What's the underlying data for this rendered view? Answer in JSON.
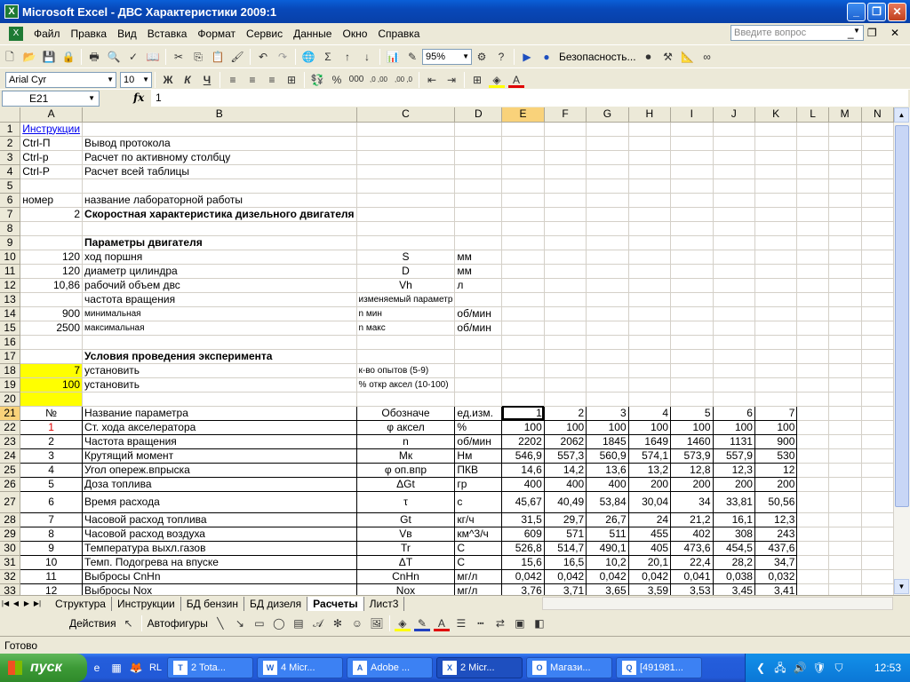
{
  "window": {
    "title": "Microsoft Excel - ДВС Характеристики 2009:1",
    "min": "_",
    "max": "❐",
    "close": "✕"
  },
  "menu": {
    "items": [
      "Файл",
      "Правка",
      "Вид",
      "Вставка",
      "Формат",
      "Сервис",
      "Данные",
      "Окно",
      "Справка"
    ],
    "help_placeholder": "Введите вопрос",
    "doc_buttons": "_ ❐ ✕"
  },
  "toolbar1": {
    "zoom": "95%",
    "security": "Безопасность..."
  },
  "toolbar2": {
    "font": "Arial Cyr",
    "size": "10",
    "bold": "Ж",
    "italic": "К",
    "underline": "Ч",
    "percent": "%",
    "thousands": "000",
    "dec_inc": ",0 ,00",
    "dec_dec": ",00 ,0"
  },
  "formula": {
    "cell": "E21",
    "fx": "fx",
    "value": "1"
  },
  "columns": [
    "A",
    "B",
    "C",
    "D",
    "E",
    "F",
    "G",
    "H",
    "I",
    "J",
    "K",
    "L",
    "M",
    "N"
  ],
  "rows": [
    {
      "n": "1",
      "A": "Инструкции"
    },
    {
      "n": "2",
      "A": "Ctrl-П",
      "B": "Вывод протокола"
    },
    {
      "n": "3",
      "A": "Ctrl-р",
      "B": "Расчет по активному столбцу"
    },
    {
      "n": "4",
      "A": "Ctrl-Р",
      "B": "Расчет всей таблицы"
    },
    {
      "n": "5"
    },
    {
      "n": "6",
      "A": "номер",
      "B": "название лабораторной работы"
    },
    {
      "n": "7",
      "A": "2",
      "B": "Скоростная характеристика дизельного двигателя"
    },
    {
      "n": "8"
    },
    {
      "n": "9",
      "B": "Параметры двигателя"
    },
    {
      "n": "10",
      "A": "120",
      "B": "ход поршня",
      "C": "S",
      "D": "мм"
    },
    {
      "n": "11",
      "A": "120",
      "B": "диаметр цилиндра",
      "C": "D",
      "D": "мм"
    },
    {
      "n": "12",
      "A": "10,86",
      "B": "рабочий объем двс",
      "C": "Vh",
      "D": "л"
    },
    {
      "n": "13",
      "B": "частота вращения",
      "C": "изменяемый параметр"
    },
    {
      "n": "14",
      "A": "900",
      "B": "минимальная",
      "C": "n мин",
      "D": "об/мин"
    },
    {
      "n": "15",
      "A": "2500",
      "B": "максимальная",
      "C": "n макс",
      "D": "об/мин"
    },
    {
      "n": "16"
    },
    {
      "n": "17",
      "B": "Условия проведения эксперимента"
    },
    {
      "n": "18",
      "A": "7",
      "B": "установить",
      "C": "к-во опытов (5-9)"
    },
    {
      "n": "19",
      "A": "100",
      "B": "установить",
      "C": "% откр аксел (10-100)"
    },
    {
      "n": "20"
    },
    {
      "n": "21",
      "A": "№",
      "B": "Название параметра",
      "C": "Обозначе",
      "D": "ед.изм.",
      "E": "1",
      "F": "2",
      "G": "3",
      "H": "4",
      "I": "5",
      "J": "6",
      "K": "7"
    },
    {
      "n": "22",
      "A": "1",
      "B": "Ст. хода акселератора",
      "C": "φ аксел",
      "D": "%",
      "E": "100",
      "F": "100",
      "G": "100",
      "H": "100",
      "I": "100",
      "J": "100",
      "K": "100"
    },
    {
      "n": "23",
      "A": "2",
      "B": "Частота вращения",
      "C": "n",
      "D": "об/мин",
      "E": "2202",
      "F": "2062",
      "G": "1845",
      "H": "1649",
      "I": "1460",
      "J": "1131",
      "K": "900"
    },
    {
      "n": "24",
      "A": "3",
      "B": "Крутящий момент",
      "C": "Мк",
      "D": "Нм",
      "E": "546,9",
      "F": "557,3",
      "G": "560,9",
      "H": "574,1",
      "I": "573,9",
      "J": "557,9",
      "K": "530"
    },
    {
      "n": "25",
      "A": "4",
      "B": "Угол опереж.впрыска",
      "C": "φ оп.впр",
      "D": "ПКВ",
      "E": "14,6",
      "F": "14,2",
      "G": "13,6",
      "H": "13,2",
      "I": "12,8",
      "J": "12,3",
      "K": "12"
    },
    {
      "n": "26",
      "A": "5",
      "B": "Доза топлива",
      "C": "ΔGt",
      "D": "гр",
      "E": "400",
      "F": "400",
      "G": "400",
      "H": "200",
      "I": "200",
      "J": "200",
      "K": "200"
    },
    {
      "n": "27",
      "A": "6",
      "B": "Время расхода",
      "C": "τ",
      "D": "с",
      "E": "45,67",
      "F": "40,49",
      "G": "53,84",
      "H": "30,04",
      "I": "34",
      "J": "33,81",
      "K": "50,56"
    },
    {
      "n": "28",
      "A": "7",
      "B": "Часовой расход топлива",
      "C": "Gt",
      "D": "кг/ч",
      "E": "31,5",
      "F": "29,7",
      "G": "26,7",
      "H": "24",
      "I": "21,2",
      "J": "16,1",
      "K": "12,3"
    },
    {
      "n": "29",
      "A": "8",
      "B": "Часовой расход воздуха",
      "C": "Vв",
      "D": "км^3/ч",
      "E": "609",
      "F": "571",
      "G": "511",
      "H": "455",
      "I": "402",
      "J": "308",
      "K": "243"
    },
    {
      "n": "30",
      "A": "9",
      "B": "Температура выхл.газов",
      "C": "Tr",
      "D": "C",
      "E": "526,8",
      "F": "514,7",
      "G": "490,1",
      "H": "405",
      "I": "473,6",
      "J": "454,5",
      "K": "437,6"
    },
    {
      "n": "31",
      "A": "10",
      "B": "Темп. Подогрева на впуске",
      "C": "ΔT",
      "D": "C",
      "E": "15,6",
      "F": "16,5",
      "G": "10,2",
      "H": "20,1",
      "I": "22,4",
      "J": "28,2",
      "K": "34,7"
    },
    {
      "n": "32",
      "A": "11",
      "B": "Выбросы CnHn",
      "C": "CnHn",
      "D": "мг/л",
      "E": "0,042",
      "F": "0,042",
      "G": "0,042",
      "H": "0,042",
      "I": "0,041",
      "J": "0,038",
      "K": "0,032"
    },
    {
      "n": "33",
      "A": "12",
      "B": "Выбросы Nox",
      "C": "Nox",
      "D": "мг/л",
      "E": "3,76",
      "F": "3,71",
      "G": "3,65",
      "H": "3,59",
      "I": "3,53",
      "J": "3,45",
      "K": "3,41"
    }
  ],
  "sheet_tabs": [
    "Структура",
    "Инструкции",
    "БД бензин",
    "БД дизеля",
    "Расчеты",
    "Лист3"
  ],
  "drawing": {
    "actions": "Действия",
    "autoshapes": "Автофигуры"
  },
  "status": "Готово",
  "taskbar": {
    "start": "пуск",
    "quick_rl": "RL",
    "buttons": [
      {
        "label": "2 Tota...",
        "icon": "T"
      },
      {
        "label": "4 Micr...",
        "icon": "W"
      },
      {
        "label": "Adobe ...",
        "icon": "A"
      },
      {
        "label": "2 Micr...",
        "icon": "X"
      },
      {
        "label": "Магази...",
        "icon": "O"
      },
      {
        "label": "[491981...",
        "icon": "Q"
      }
    ],
    "clock": "12:53"
  }
}
